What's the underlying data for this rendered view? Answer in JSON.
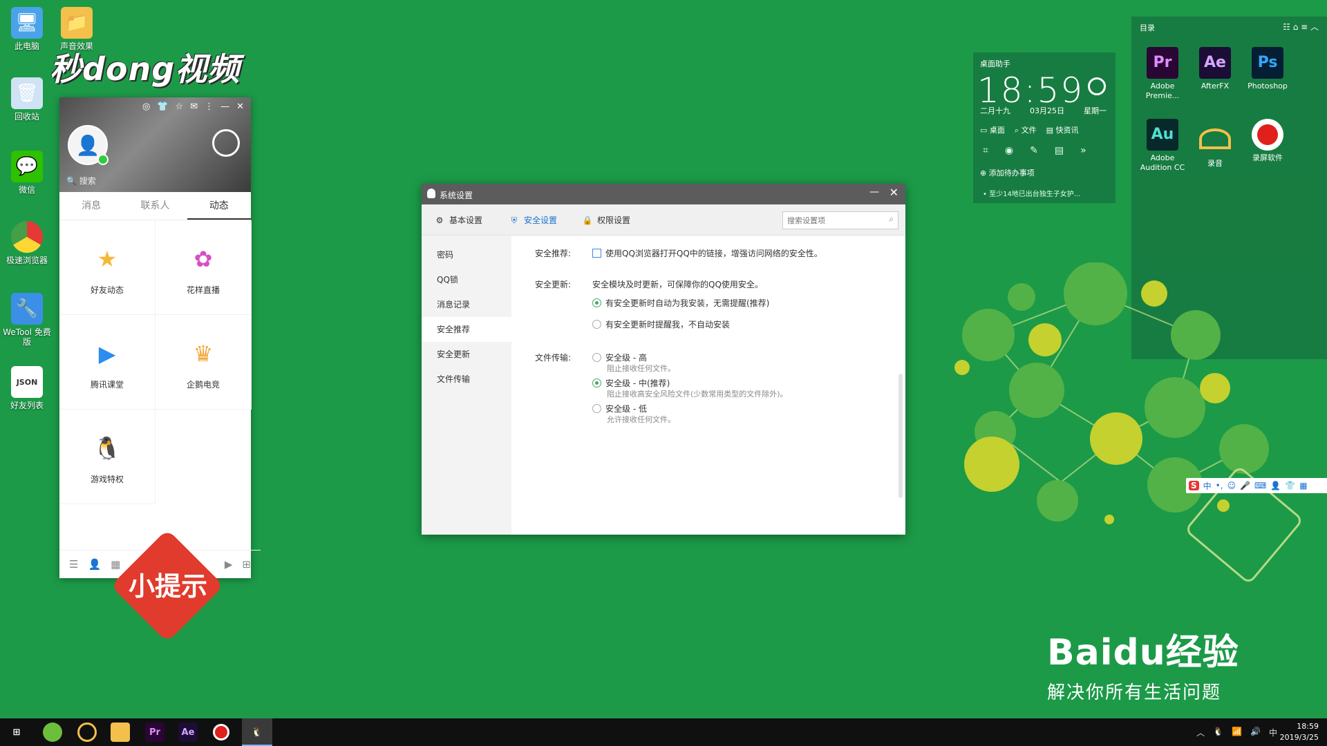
{
  "desktop": {
    "icons": [
      {
        "label": "此电脑"
      },
      {
        "label": "声音效果"
      },
      {
        "label": "回收站"
      },
      {
        "label": "微信"
      },
      {
        "label": "极速浏览器"
      },
      {
        "label": "WeTool 免费版"
      },
      {
        "label": "好友列表"
      }
    ]
  },
  "watermark": {
    "logo": "秒dong视频",
    "tip": "小提示",
    "baidu_brand": "Baidu经验",
    "baidu_slogan": "解决你所有生活问题"
  },
  "qq_panel": {
    "search_placeholder": "搜索",
    "tabs": [
      "消息",
      "联系人",
      "动态"
    ],
    "apps": [
      {
        "label": "好友动态"
      },
      {
        "label": "花样直播"
      },
      {
        "label": "腾讯课堂"
      },
      {
        "label": "企鹅电竞"
      },
      {
        "label": "游戏特权"
      }
    ]
  },
  "dialog": {
    "title": "系统设置",
    "toolbar": {
      "basic": "基本设置",
      "security": "安全设置",
      "permission": "权限设置",
      "search_placeholder": "搜索设置项"
    },
    "sidebar": [
      "密码",
      "QQ锁",
      "消息记录",
      "安全推荐",
      "安全更新",
      "文件传输"
    ],
    "content": {
      "recommend_label": "安全推荐:",
      "recommend_checkbox": "使用QQ浏览器打开QQ中的链接，增强访问网络的安全性。",
      "update_label": "安全更新:",
      "update_desc": "安全模块及时更新，可保障你的QQ使用安全。",
      "update_auto": "有安全更新时自动为我安装，无需提醒(推荐)",
      "update_notify": "有安全更新时提醒我，不自动安装",
      "file_label": "文件传输:",
      "level_high": "安全级 - 高",
      "level_high_desc": "阻止接收任何文件。",
      "level_mid": "安全级 - 中(推荐)",
      "level_mid_desc": "阻止接收高安全风险文件(少数常用类型的文件除外)。",
      "level_low": "安全级 - 低",
      "level_low_desc": "允许接收任何文件。"
    }
  },
  "assistant": {
    "title": "桌面助手",
    "time": "18:59",
    "lunar": "二月十九",
    "date": "03月25日",
    "weekday": "星期一",
    "actions": [
      "桌面",
      "文件",
      "快资讯"
    ],
    "todo": "添加待办事项",
    "news": "• 至少14地已出台独生子女护..."
  },
  "directory": {
    "title": "目录",
    "apps": [
      {
        "tile": "Pr",
        "label": "Adobe Premie..."
      },
      {
        "tile": "Ae",
        "label": "AfterFX"
      },
      {
        "tile": "Ps",
        "label": "Photoshop"
      },
      {
        "tile": "Au",
        "label": "Adobe Audition CC"
      },
      {
        "tile": "",
        "label": "录音"
      },
      {
        "tile": "",
        "label": "录屏软件"
      }
    ]
  },
  "taskbar": {
    "pinned": [
      "Pr",
      "Ae"
    ],
    "ime": "中",
    "clock_time": "18:59",
    "clock_date": "2019/3/25"
  },
  "colors": {
    "desktop_bg": "#1c9a48",
    "accent_blue": "#1a73d1",
    "radio_green": "#44a862",
    "tip_red": "#e03b2c"
  }
}
